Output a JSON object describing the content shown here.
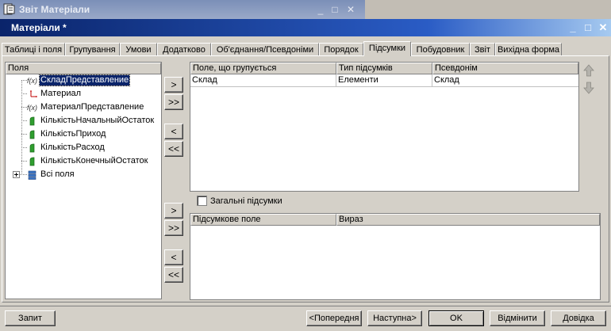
{
  "background_window": {
    "title": "Звіт Матеріали"
  },
  "window": {
    "title": "Матеріали *"
  },
  "tabs": [
    {
      "label": "Таблиці і поля"
    },
    {
      "label": "Групування"
    },
    {
      "label": "Умови"
    },
    {
      "label": "Додатково"
    },
    {
      "label": "Об'єднання/Псевдоніми"
    },
    {
      "label": "Порядок"
    },
    {
      "label": "Підсумки"
    },
    {
      "label": "Побудовник"
    },
    {
      "label": "Звіт"
    },
    {
      "label": "Вихідна форма"
    }
  ],
  "active_tab": "Підсумки",
  "fields_tree": {
    "header": "Поля",
    "items": [
      {
        "label": "СкладПредставление",
        "icon": "function-icon",
        "selected": true
      },
      {
        "label": "Материал",
        "icon": "link-icon"
      },
      {
        "label": "МатериалПредставление",
        "icon": "function-icon"
      },
      {
        "label": "КількістьНачальныйОстаток",
        "icon": "number-field-icon"
      },
      {
        "label": "КількістьПриход",
        "icon": "number-field-icon"
      },
      {
        "label": "КількістьРасход",
        "icon": "number-field-icon"
      },
      {
        "label": "КількістьКонечныйОстаток",
        "icon": "number-field-icon"
      },
      {
        "label": "Всі поля",
        "icon": "table-stack-icon",
        "expandable": true
      }
    ]
  },
  "group_arrows": {
    "add": ">",
    "add_all": ">>",
    "remove": "<",
    "remove_all": "<<"
  },
  "total_arrows": {
    "add": ">",
    "add_all": ">>",
    "remove": "<",
    "remove_all": "<<"
  },
  "group_table": {
    "columns": [
      "Поле, що групується",
      "Тип підсумків",
      "Псевдонім"
    ],
    "rows": [
      [
        "Склад",
        "Елементи",
        "Склад"
      ]
    ]
  },
  "general_totals": {
    "label": "Загальні підсумки",
    "checked": false
  },
  "totals_table": {
    "columns": [
      "Підсумкове поле",
      "Вираз"
    ],
    "rows": []
  },
  "buttons": {
    "query": "Запит",
    "prev": "<Попередня",
    "next": "Наступна>",
    "ok": "OK",
    "cancel": "Відмінити",
    "help": "Довідка"
  },
  "colors": {
    "selection": "#0a246a",
    "titlebar": "#0a246a",
    "face": "#d4d0c8"
  }
}
